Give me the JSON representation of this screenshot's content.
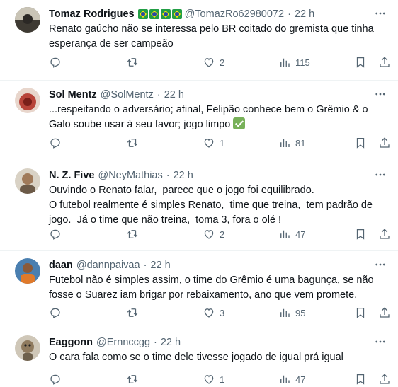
{
  "tweets": [
    {
      "name": "Tomaz Rodrigues",
      "handle": "@TomazRo62980072",
      "time": "22 h",
      "text": "Renato gaúcho não se interessa pelo BR coitado do gremista que tinha esperança de ser campeão",
      "likes": "2",
      "views": "115",
      "flag_count": 4
    },
    {
      "name": "Sol Mentz",
      "handle": "@SolMentz",
      "time": "22 h",
      "text": "...respeitando o adversário; afinal, Felipão conhece bem o Grêmio & o Galo soube usar à seu favor; jogo limpo",
      "likes": "1",
      "views": "81"
    },
    {
      "name": "N. Z. Five",
      "handle": "@NeyMathias",
      "time": "22 h",
      "text": "Ouvindo o Renato falar,  parece que o jogo foi equilibrado.\nO futebol realmente é simples Renato,  time que treina,  tem padrão de jogo.  Já o time que não treina,  toma 3, fora o olé !",
      "likes": "2",
      "views": "47"
    },
    {
      "name": "daan",
      "handle": "@dannpaivaa",
      "time": "22 h",
      "text": "Futebol não é simples assim, o time do Grêmio é uma bagunça, se não fosse o Suarez iam brigar por rebaixamento, ano que vem promete.",
      "likes": "3",
      "views": "95"
    },
    {
      "name": "Eaggonn",
      "handle": "@Ernnccgg",
      "time": "22 h",
      "text": "O cara fala como se o time dele tivesse jogado de igual prá igual",
      "likes": "1",
      "views": "47"
    }
  ],
  "icons": [
    "reply-icon",
    "retweet-icon",
    "like-icon",
    "views-icon",
    "bookmark-icon",
    "share-icon",
    "more-icon"
  ],
  "colors": {
    "text": "#0f1419",
    "secondary": "#536471",
    "divider": "#eff3f4"
  }
}
